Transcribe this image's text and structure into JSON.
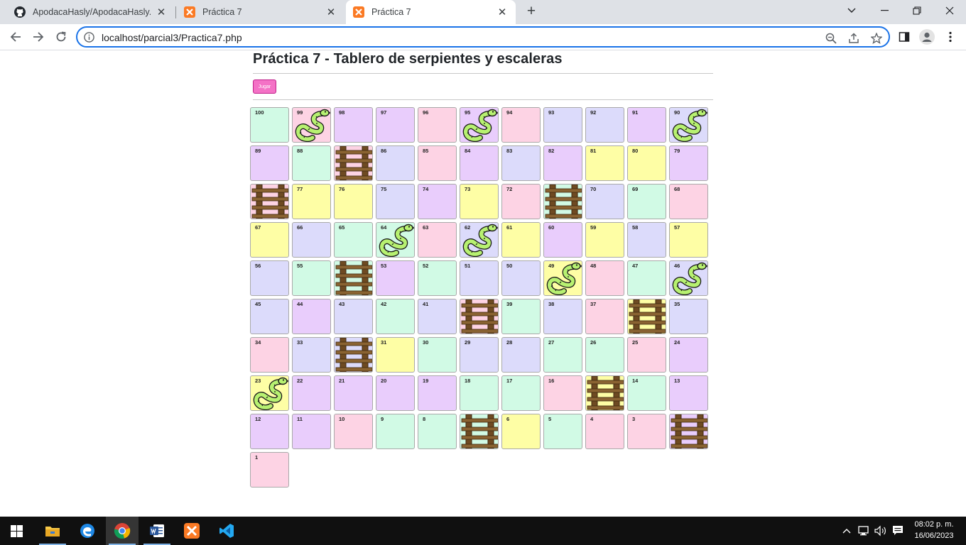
{
  "browser": {
    "tabs": [
      {
        "title": "ApodacaHasly/ApodacaHasly.gith",
        "icon": "github-icon",
        "active": false
      },
      {
        "title": "Práctica 7",
        "icon": "xampp-icon",
        "active": false
      },
      {
        "title": "Práctica 7",
        "icon": "xampp-icon",
        "active": true
      }
    ],
    "url": "localhost/parcial3/Practica7.php"
  },
  "page": {
    "title": "Práctica 7 - Tablero de serpientes y escaleras",
    "play_button": "Jugar"
  },
  "board": {
    "colors": {
      "green": "#d1fae5",
      "purple": "#e9cdfc",
      "pink": "#fdd3e4",
      "lavender": "#dcdbfb",
      "yellow": "#fefea5"
    },
    "rows": [
      [
        {
          "n": "100",
          "c": "green"
        },
        {
          "n": "99",
          "c": "pink",
          "i": "snake"
        },
        {
          "n": "98",
          "c": "purple"
        },
        {
          "n": "97",
          "c": "purple"
        },
        {
          "n": "96",
          "c": "pink"
        },
        {
          "n": "95",
          "c": "purple",
          "i": "snake"
        },
        {
          "n": "94",
          "c": "pink"
        },
        {
          "n": "93",
          "c": "lavender"
        },
        {
          "n": "92",
          "c": "lavender"
        },
        {
          "n": "91",
          "c": "purple"
        },
        {
          "n": "90",
          "c": "lavender",
          "i": "snake"
        }
      ],
      [
        {
          "n": "89",
          "c": "purple"
        },
        {
          "n": "88",
          "c": "green"
        },
        {
          "n": "87",
          "c": "pink",
          "i": "ladder"
        },
        {
          "n": "86",
          "c": "lavender"
        },
        {
          "n": "85",
          "c": "pink"
        },
        {
          "n": "84",
          "c": "purple"
        },
        {
          "n": "83",
          "c": "lavender"
        },
        {
          "n": "82",
          "c": "purple"
        },
        {
          "n": "81",
          "c": "yellow"
        },
        {
          "n": "80",
          "c": "yellow"
        },
        {
          "n": "79",
          "c": "purple"
        }
      ],
      [
        {
          "n": "78",
          "c": "pink",
          "i": "ladder"
        },
        {
          "n": "77",
          "c": "yellow"
        },
        {
          "n": "76",
          "c": "yellow"
        },
        {
          "n": "75",
          "c": "lavender"
        },
        {
          "n": "74",
          "c": "purple"
        },
        {
          "n": "73",
          "c": "yellow"
        },
        {
          "n": "72",
          "c": "pink"
        },
        {
          "n": "71",
          "c": "green",
          "i": "ladder"
        },
        {
          "n": "70",
          "c": "lavender"
        },
        {
          "n": "69",
          "c": "green"
        },
        {
          "n": "68",
          "c": "pink"
        }
      ],
      [
        {
          "n": "67",
          "c": "yellow"
        },
        {
          "n": "66",
          "c": "lavender"
        },
        {
          "n": "65",
          "c": "green"
        },
        {
          "n": "64",
          "c": "green",
          "i": "snake"
        },
        {
          "n": "63",
          "c": "pink"
        },
        {
          "n": "62",
          "c": "lavender",
          "i": "snake"
        },
        {
          "n": "61",
          "c": "yellow"
        },
        {
          "n": "60",
          "c": "purple"
        },
        {
          "n": "59",
          "c": "yellow"
        },
        {
          "n": "58",
          "c": "lavender"
        },
        {
          "n": "57",
          "c": "yellow"
        }
      ],
      [
        {
          "n": "56",
          "c": "lavender"
        },
        {
          "n": "55",
          "c": "green"
        },
        {
          "n": "54",
          "c": "green",
          "i": "ladder"
        },
        {
          "n": "53",
          "c": "purple"
        },
        {
          "n": "52",
          "c": "green"
        },
        {
          "n": "51",
          "c": "lavender"
        },
        {
          "n": "50",
          "c": "lavender"
        },
        {
          "n": "49",
          "c": "yellow",
          "i": "snake"
        },
        {
          "n": "48",
          "c": "pink"
        },
        {
          "n": "47",
          "c": "green"
        },
        {
          "n": "46",
          "c": "lavender",
          "i": "snake"
        }
      ],
      [
        {
          "n": "45",
          "c": "lavender"
        },
        {
          "n": "44",
          "c": "purple"
        },
        {
          "n": "43",
          "c": "lavender"
        },
        {
          "n": "42",
          "c": "green"
        },
        {
          "n": "41",
          "c": "lavender"
        },
        {
          "n": "40",
          "c": "pink",
          "i": "ladder"
        },
        {
          "n": "39",
          "c": "green"
        },
        {
          "n": "38",
          "c": "lavender"
        },
        {
          "n": "37",
          "c": "pink"
        },
        {
          "n": "36",
          "c": "yellow",
          "i": "ladder"
        },
        {
          "n": "35",
          "c": "lavender"
        }
      ],
      [
        {
          "n": "34",
          "c": "pink"
        },
        {
          "n": "33",
          "c": "lavender"
        },
        {
          "n": "32",
          "c": "lavender",
          "i": "ladder"
        },
        {
          "n": "31",
          "c": "yellow"
        },
        {
          "n": "30",
          "c": "green"
        },
        {
          "n": "29",
          "c": "lavender"
        },
        {
          "n": "28",
          "c": "lavender"
        },
        {
          "n": "27",
          "c": "green"
        },
        {
          "n": "26",
          "c": "green"
        },
        {
          "n": "25",
          "c": "pink"
        },
        {
          "n": "24",
          "c": "purple"
        }
      ],
      [
        {
          "n": "23",
          "c": "yellow",
          "i": "snake"
        },
        {
          "n": "22",
          "c": "purple"
        },
        {
          "n": "21",
          "c": "purple"
        },
        {
          "n": "20",
          "c": "purple"
        },
        {
          "n": "19",
          "c": "purple"
        },
        {
          "n": "18",
          "c": "green"
        },
        {
          "n": "17",
          "c": "green"
        },
        {
          "n": "16",
          "c": "pink"
        },
        {
          "n": "15",
          "c": "yellow",
          "i": "ladder"
        },
        {
          "n": "14",
          "c": "green"
        },
        {
          "n": "13",
          "c": "purple"
        }
      ],
      [
        {
          "n": "12",
          "c": "purple"
        },
        {
          "n": "11",
          "c": "purple"
        },
        {
          "n": "10",
          "c": "pink"
        },
        {
          "n": "9",
          "c": "green"
        },
        {
          "n": "8",
          "c": "green"
        },
        {
          "n": "7",
          "c": "green",
          "i": "ladder"
        },
        {
          "n": "6",
          "c": "yellow"
        },
        {
          "n": "5",
          "c": "green"
        },
        {
          "n": "4",
          "c": "pink"
        },
        {
          "n": "3",
          "c": "pink"
        },
        {
          "n": "2",
          "c": "purple",
          "i": "ladder"
        }
      ],
      [
        {
          "n": "1",
          "c": "pink"
        }
      ]
    ]
  },
  "taskbar": {
    "apps": [
      "start-icon",
      "file-explorer-icon",
      "edge-icon",
      "chrome-icon",
      "word-icon",
      "xampp-icon",
      "vscode-icon"
    ],
    "time": "08:02 p. m.",
    "date": "16/06/2023"
  }
}
